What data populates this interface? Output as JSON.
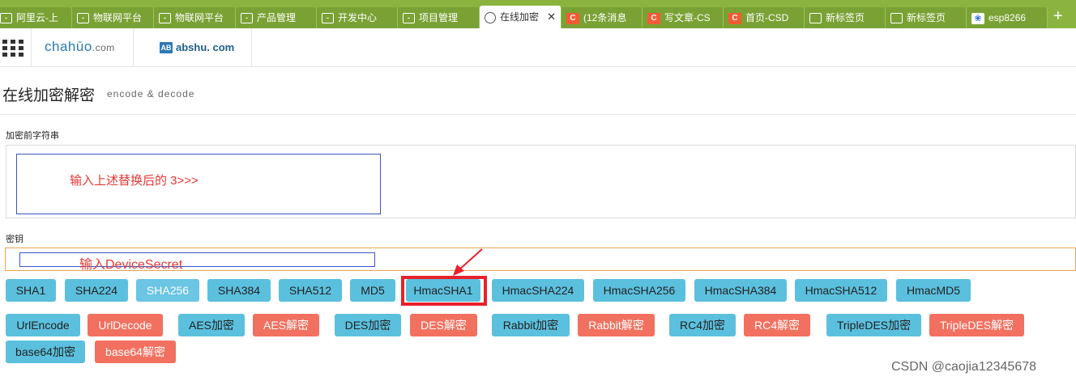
{
  "browser": {
    "tabs": [
      {
        "label": "阿里云-上",
        "icon": "bracket-icon"
      },
      {
        "label": "物联网平台",
        "icon": "bracket-icon"
      },
      {
        "label": "物联网平台",
        "icon": "bracket-icon"
      },
      {
        "label": "产品管理",
        "icon": "bracket-icon"
      },
      {
        "label": "开发中心",
        "icon": "bracket-icon"
      },
      {
        "label": "项目管理",
        "icon": "bracket-icon"
      },
      {
        "label": "在线加密",
        "icon": "globe-icon",
        "close": "✕"
      },
      {
        "label": "(12条消息",
        "icon": "csdn-icon"
      },
      {
        "label": "写文章-CS",
        "icon": "csdn-icon"
      },
      {
        "label": "首页-CSD",
        "icon": "csdn-icon"
      },
      {
        "label": "新标签页",
        "icon": "newtab-icon"
      },
      {
        "label": "新标签页",
        "icon": "newtab-icon"
      },
      {
        "label": "esp8266",
        "icon": "baidu-paw-icon"
      }
    ],
    "new_tab": "+"
  },
  "header": {
    "logo_main": "chahūo",
    "logo_main_suffix": ".com",
    "logo_second_badge": "AB",
    "logo_second": "abshu. com"
  },
  "page": {
    "title": "在线加密解密",
    "subtitle": "encode & decode",
    "plain_label": "加密前字符串",
    "plain_annotation": "输入上述替换后的 3>>>",
    "key_label": "密钥",
    "key_annotation": "输入DeviceSecret"
  },
  "buttons_row1": [
    "SHA1",
    "SHA224",
    "SHA256",
    "SHA384",
    "SHA512",
    "MD5",
    "HmacSHA1",
    "HmacSHA224",
    "HmacSHA256",
    "HmacSHA384",
    "HmacSHA512",
    "HmacMD5"
  ],
  "buttons_row2": [
    "UrlEncode",
    "UrlDecode",
    "AES加密",
    "AES解密",
    "DES加密",
    "DES解密",
    "Rabbit加密",
    "Rabbit解密",
    "RC4加密",
    "RC4解密",
    "TripleDES加密",
    "TripleDES解密"
  ],
  "buttons_row3": [
    "base64加密",
    "base64解密"
  ],
  "colors": {
    "blue_button": "#5bc0de",
    "red_button": "#f2705f",
    "annotation_red": "#e53935",
    "tabbar": "#8ab43f"
  },
  "watermark": "CSDN @caojia12345678"
}
